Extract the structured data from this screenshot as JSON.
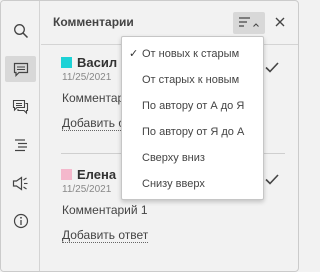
{
  "panel": {
    "title": "Комментарии"
  },
  "toolbar": {
    "items": [
      {
        "icon": "search-icon"
      },
      {
        "icon": "comments-icon",
        "active": true
      },
      {
        "icon": "chat-icon"
      },
      {
        "icon": "navigation-icon"
      },
      {
        "icon": "speaker-icon"
      },
      {
        "icon": "info-icon"
      }
    ]
  },
  "sort_menu": {
    "items": [
      {
        "label": "От новых к старым",
        "checked": true
      },
      {
        "label": "От старых к новым",
        "checked": false
      },
      {
        "label": "По автору от А до Я",
        "checked": false
      },
      {
        "label": "По автору от Я до А",
        "checked": false
      },
      {
        "label": "Сверху вниз",
        "checked": false
      },
      {
        "label": "Снизу вверх",
        "checked": false
      }
    ],
    "check_mark": "✓"
  },
  "comments": [
    {
      "author": "Васил",
      "author_color": "#1dd2d6",
      "date": "11/25/2021",
      "text": "Комментар",
      "reply_label": "Добавить о"
    },
    {
      "author": "Елена",
      "author_color": "#f4b8cc",
      "date": "11/25/2021",
      "text": "Комментарий 1",
      "reply_label": "Добавить ответ"
    }
  ],
  "colors": {
    "background": "#f2f2f2",
    "active_button": "#d8d8d8",
    "text": "#444444"
  }
}
